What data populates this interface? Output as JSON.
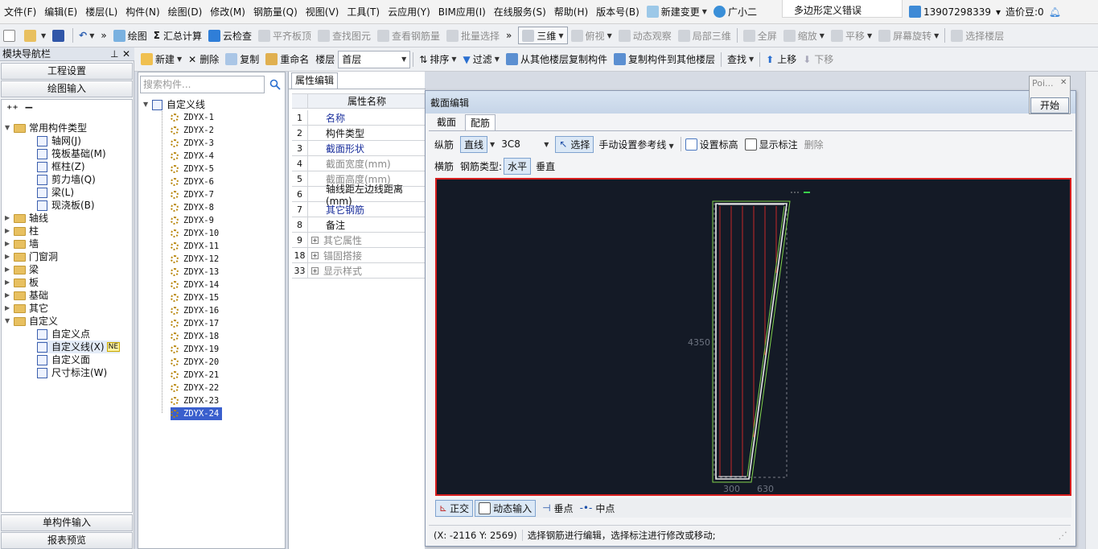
{
  "menubar": {
    "items": [
      "文件(F)",
      "编辑(E)",
      "楼层(L)",
      "构件(N)",
      "绘图(D)",
      "修改(M)",
      "钢筋量(Q)",
      "视图(V)",
      "工具(T)",
      "云应用(Y)",
      "BIM应用(I)",
      "在线服务(S)",
      "帮助(H)",
      "版本号(B)"
    ],
    "new_change": "新建变更",
    "assistant": "广小二",
    "banner": "多边形定义错误",
    "phone": "13907298339",
    "coins": "造价豆:0"
  },
  "toolbar1": {
    "draw": "绘图",
    "sum": "汇总计算",
    "cloud_check": "云检查",
    "align_slab": "平齐板顶",
    "find_elem": "查找图元",
    "view_rebar": "查看钢筋量",
    "batch_select": "批量选择",
    "view3d": "三维",
    "top_view": "俯视",
    "dyn_view": "动态观察",
    "local3d": "局部三维",
    "fullscreen": "全屏",
    "zoom": "缩放",
    "pan": "平移",
    "rotate": "屏幕旋转",
    "select_floor": "选择楼层"
  },
  "toolbar2": {
    "new": "新建",
    "delete": "删除",
    "copy": "复制",
    "rename": "重命名",
    "floor_label": "楼层",
    "floor_value": "首层",
    "sort": "排序",
    "filter": "过滤",
    "copy_from": "从其他楼层复制构件",
    "copy_to": "复制构件到其他楼层",
    "find": "查找",
    "up": "上移",
    "down": "下移"
  },
  "nav": {
    "title": "模块导航栏",
    "project_settings": "工程设置",
    "drawing_input": "绘图输入",
    "single_input": "单构件输入",
    "report_preview": "报表预览",
    "tree": {
      "common": "常用构件类型",
      "common_children": [
        "轴网(J)",
        "筏板基础(M)",
        "框柱(Z)",
        "剪力墙(Q)",
        "梁(L)",
        "现浇板(B)"
      ],
      "groups": [
        "轴线",
        "柱",
        "墙",
        "门窗洞",
        "梁",
        "板",
        "基础",
        "其它"
      ],
      "custom": "自定义",
      "custom_children": [
        "自定义点",
        "自定义线(X)",
        "自定义面",
        "尺寸标注(W)"
      ],
      "new_badge": "NE"
    }
  },
  "components": {
    "search_placeholder": "搜索构件...",
    "root": "自定义线",
    "items": [
      "ZDYX-1",
      "ZDYX-2",
      "ZDYX-3",
      "ZDYX-4",
      "ZDYX-5",
      "ZDYX-6",
      "ZDYX-7",
      "ZDYX-8",
      "ZDYX-9",
      "ZDYX-10",
      "ZDYX-11",
      "ZDYX-12",
      "ZDYX-13",
      "ZDYX-14",
      "ZDYX-15",
      "ZDYX-16",
      "ZDYX-17",
      "ZDYX-18",
      "ZDYX-19",
      "ZDYX-20",
      "ZDYX-21",
      "ZDYX-22",
      "ZDYX-23",
      "ZDYX-24"
    ],
    "selected_index": 23
  },
  "properties": {
    "tab": "属性编辑",
    "header": "属性名称",
    "rows": [
      {
        "no": "1",
        "name": "名称",
        "style": "blue"
      },
      {
        "no": "2",
        "name": "构件类型",
        "style": "normal"
      },
      {
        "no": "3",
        "name": "截面形状",
        "style": "blue"
      },
      {
        "no": "4",
        "name": "截面宽度(mm)",
        "style": "gray"
      },
      {
        "no": "5",
        "name": "截面高度(mm)",
        "style": "gray"
      },
      {
        "no": "6",
        "name": "轴线距左边线距离(mm)",
        "style": "normal"
      },
      {
        "no": "7",
        "name": "其它钢筋",
        "style": "blue"
      },
      {
        "no": "8",
        "name": "备注",
        "style": "normal"
      },
      {
        "no": "9",
        "name": "其它属性",
        "style": "gray",
        "expand": true
      },
      {
        "no": "18",
        "name": "锚固搭接",
        "style": "gray",
        "expand": true
      },
      {
        "no": "33",
        "name": "显示样式",
        "style": "gray",
        "expand": true
      }
    ]
  },
  "dialog": {
    "title": "截面编辑",
    "tabs": [
      "截面",
      "配筋"
    ],
    "longitudinal": "纵筋",
    "line_mode": "直线",
    "rebar_spec": "3C8",
    "select": "选择",
    "manual_ref": "手动设置参考线",
    "set_elev": "设置标高",
    "show_dims": "显示标注",
    "delete": "删除",
    "transverse": "横筋",
    "rebar_type_label": "钢筋类型:",
    "horizontal": "水平",
    "vertical": "垂直",
    "dim_left": "4350",
    "dim_bottom1": "300",
    "dim_bottom2": "630",
    "ortho": "正交",
    "dyn_input": "动态输入",
    "perp_point": "垂点",
    "mid_point": "中点",
    "status_coords": "(X: -2116 Y: 2569)",
    "status_msg": "选择钢筋进行编辑，选择标注进行修改或移动;"
  },
  "popup": {
    "title": "Poi...",
    "start": "开始"
  },
  "colors": {
    "canvas_bg": "#141a26",
    "canvas_border": "#d81e1e",
    "section_outline": "#e8e8e8",
    "rebar": "#c62828",
    "rebar_slant": "#7fd24b",
    "selected_bg": "#3a5fcd"
  }
}
